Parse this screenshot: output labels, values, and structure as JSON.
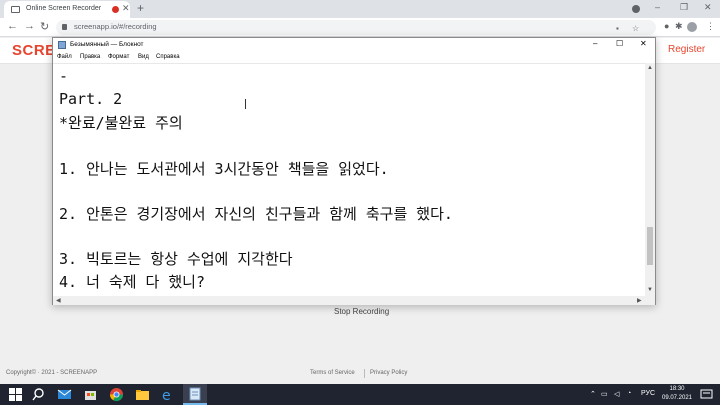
{
  "browser": {
    "tab_title": "Online Screen Recorder",
    "tab_close": "✕",
    "new_tab": "+",
    "url": "screenapp.io/#/recording",
    "window_controls": [
      "–",
      "❐",
      "✕"
    ]
  },
  "site": {
    "logo": "SCRE",
    "register": "Register",
    "stop_recording": "Stop Recording",
    "copyright": "Copyright© · 2021 - SCREENAPP",
    "terms": "Terms of Service",
    "privacy": "Privacy Policy"
  },
  "notepad": {
    "title": "Безымянный — Блокнот",
    "controls": [
      "–",
      "☐",
      "✕"
    ],
    "menu": [
      "Файл",
      "Правка",
      "Формат",
      "Вид",
      "Справка"
    ],
    "lines": [
      "-",
      "Part. 2",
      "*완료/불완료 주의",
      "",
      "1. 안나는 도서관에서 3시간동안 책들을 읽었다.",
      "",
      "2. 안톤은 경기장에서 자신의 친구들과 함께 축구를 했다.",
      "",
      "3. 빅토르는 항상 수업에 지각한다",
      "4. 너 숙제 다 했니?"
    ]
  },
  "taskbar": {
    "language": "РУС",
    "time": "18:30",
    "date": "09.07.2021"
  },
  "colors": {
    "brand": "#e8452e",
    "taskbar": "#1f2430"
  }
}
